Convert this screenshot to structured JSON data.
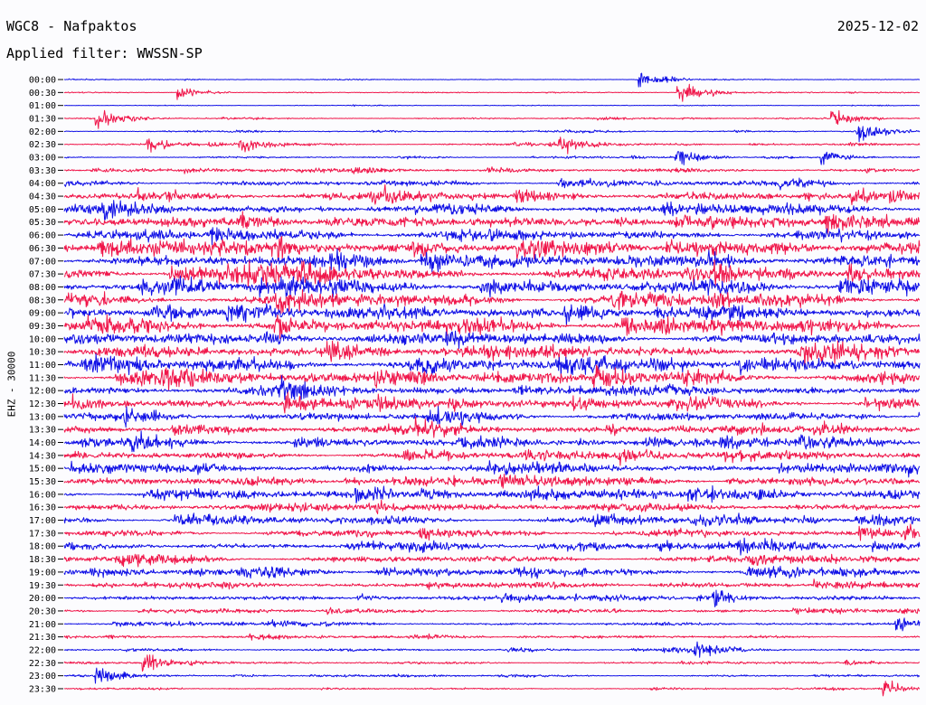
{
  "header": {
    "station": "WGC8 - Nafpaktos",
    "date": "2025-12-02",
    "filter_label": "Applied filter: WWSSN-SP"
  },
  "colors": {
    "odd_trace": "#1010e6",
    "even_trace": "#f0164a",
    "background": "#fcfcfe"
  },
  "chart_data": {
    "type": "line",
    "title": "WGC8 - Nafpaktos",
    "ylabel": "EHZ - 30000",
    "xlabel": "",
    "y_axis": "start time of each 30-minute trace row",
    "rows": [
      "00:00",
      "00:30",
      "01:00",
      "01:30",
      "02:00",
      "02:30",
      "03:00",
      "03:30",
      "04:00",
      "04:30",
      "05:00",
      "05:30",
      "06:00",
      "06:30",
      "07:00",
      "07:30",
      "08:00",
      "08:30",
      "09:00",
      "09:30",
      "10:00",
      "10:30",
      "11:00",
      "11:30",
      "12:00",
      "12:30",
      "13:00",
      "13:30",
      "14:00",
      "14:30",
      "15:00",
      "15:30",
      "16:00",
      "16:30",
      "17:00",
      "17:30",
      "18:00",
      "18:30",
      "19:00",
      "19:30",
      "20:00",
      "20:30",
      "21:00",
      "21:30",
      "22:00",
      "22:30",
      "23:00",
      "23:30"
    ],
    "row_noise_level": [
      0.05,
      0.07,
      0.05,
      0.1,
      0.12,
      0.16,
      0.12,
      0.25,
      0.42,
      0.55,
      0.65,
      0.7,
      0.78,
      0.85,
      0.88,
      0.86,
      0.9,
      0.9,
      0.88,
      0.88,
      0.85,
      0.85,
      0.85,
      0.8,
      0.7,
      0.62,
      0.58,
      0.55,
      0.55,
      0.55,
      0.55,
      0.6,
      0.6,
      0.62,
      0.55,
      0.55,
      0.5,
      0.5,
      0.45,
      0.38,
      0.3,
      0.3,
      0.22,
      0.2,
      0.18,
      0.16,
      0.12,
      0.1
    ],
    "events": [
      {
        "row": "00:00",
        "at": 0.675,
        "amp": 1.0
      },
      {
        "row": "00:30",
        "at": 0.72,
        "amp": 1.6
      },
      {
        "row": "00:30",
        "at": 0.135,
        "amp": 0.8
      },
      {
        "row": "01:30",
        "at": 0.04,
        "amp": 1.2
      },
      {
        "row": "01:30",
        "at": 0.9,
        "amp": 1.0
      },
      {
        "row": "02:00",
        "at": 0.93,
        "amp": 1.2
      },
      {
        "row": "02:30",
        "at": 0.1,
        "amp": 0.9
      },
      {
        "row": "02:30",
        "at": 0.208,
        "amp": 1.0
      },
      {
        "row": "02:30",
        "at": 0.58,
        "amp": 1.0
      },
      {
        "row": "03:00",
        "at": 0.718,
        "amp": 1.2
      },
      {
        "row": "03:00",
        "at": 0.888,
        "amp": 1.0
      },
      {
        "row": "19:00",
        "at": 0.208,
        "amp": 0.9
      },
      {
        "row": "20:00",
        "at": 0.76,
        "amp": 0.9
      },
      {
        "row": "21:00",
        "at": 0.975,
        "amp": 1.0
      },
      {
        "row": "22:00",
        "at": 0.74,
        "amp": 1.2
      },
      {
        "row": "22:30",
        "at": 0.095,
        "amp": 1.1
      },
      {
        "row": "23:00",
        "at": 0.04,
        "amp": 1.3
      },
      {
        "row": "23:30",
        "at": 0.96,
        "amp": 1.2
      }
    ]
  }
}
